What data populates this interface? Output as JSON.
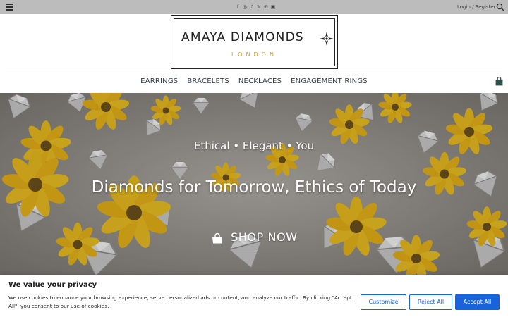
{
  "topbar": {
    "menu_icon": "hamburger-icon",
    "socials": [
      {
        "icon": "facebook-icon",
        "glyph": "f"
      },
      {
        "icon": "instagram-icon",
        "glyph": "◎"
      },
      {
        "icon": "tiktok-icon",
        "glyph": "♪"
      },
      {
        "icon": "x-icon",
        "glyph": "𝕏"
      },
      {
        "icon": "pinterest-icon",
        "glyph": "℗"
      },
      {
        "icon": "youtube-icon",
        "glyph": "▣"
      }
    ],
    "login_label": "Login / Register",
    "search_icon": "search-icon"
  },
  "header": {
    "logo": {
      "brand": "AMAYA DIAMONDS",
      "location": "LONDON",
      "emblem_icon": "diamond-star-icon",
      "accent_color": "#c9a437"
    },
    "nav": [
      "EARRINGS",
      "BRACELETS",
      "NECKLACES",
      "ENGAGEMENT RINGS"
    ],
    "cart_icon": "shopping-bag-icon"
  },
  "hero": {
    "tagline": "Ethical • Elegant • You",
    "headline": "Diamonds for Tomorrow, Ethics of Today",
    "cta_label": "SHOP NOW",
    "cta_icon": "shopping-bag-icon"
  },
  "cookie": {
    "title": "We value your privacy",
    "text": "We use cookies to enhance your browsing experience, serve personalized ads or content, and analyze our traffic. By clicking \"Accept All\", you consent to our use of cookies.",
    "customize_label": "Customize",
    "reject_label": "Reject All",
    "accept_label": "Accept All",
    "accent_color": "#1863dc"
  }
}
